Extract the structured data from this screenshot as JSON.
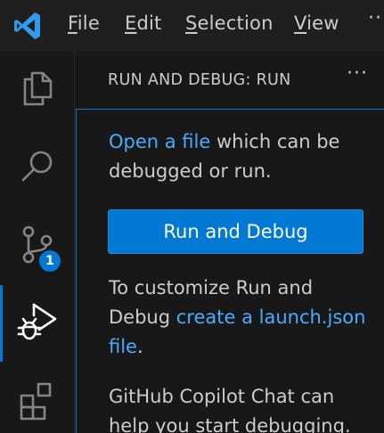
{
  "titlebar": {
    "menu": [
      {
        "mnemonic": "F",
        "rest": "ile"
      },
      {
        "mnemonic": "E",
        "rest": "dit"
      },
      {
        "mnemonic": "S",
        "rest": "election"
      },
      {
        "mnemonic": "V",
        "rest": "iew"
      }
    ],
    "more": "···"
  },
  "activitybar": {
    "icons": [
      "explorer-icon",
      "search-icon",
      "source-control-icon",
      "run-debug-icon",
      "extensions-icon"
    ],
    "scm_badge": "1",
    "accent": "#0078d4"
  },
  "sidebar": {
    "title": "RUN AND DEBUG: RUN",
    "more": "···",
    "open_file_link": "Open a file",
    "open_file_rest": " which can be debugged or run.",
    "run_button": "Run and Debug",
    "customize_pre": "To customize Run and Debug ",
    "customize_link": "create a launch.json file",
    "customize_post": ".",
    "copilot_text": "GitHub Copilot Chat can help you start debugging."
  },
  "colors": {
    "background": "#181818",
    "link": "#4daafc",
    "button": "#0078d4"
  }
}
